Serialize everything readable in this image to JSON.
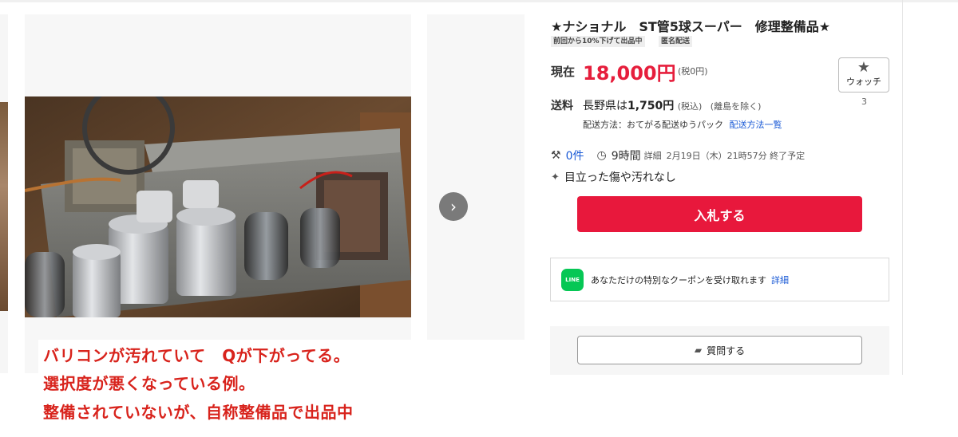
{
  "listing": {
    "title": "★ナショナル　ST管5球スーパー　修理整備品★",
    "badges": [
      "前回から10%下げて出品中",
      "匿名配送"
    ],
    "price_label": "現在",
    "price": "18,000円",
    "tax": "(税0円)"
  },
  "watch": {
    "label": "ウォッチ",
    "count": "3",
    "icon": "star-icon"
  },
  "shipping": {
    "label": "送料",
    "prefix": "長野県は",
    "fee": "1,750円",
    "tax_note": "(税込)",
    "exclusion": "(離島を除く)",
    "method_text": "配送方法：おてがる配送ゆうパック",
    "method_link": "配送方法一覧"
  },
  "meta": {
    "bids": "0件",
    "time_left": "9時間",
    "detail_link": "詳細",
    "end_date": "2月19日（木）21時57分 終了予定"
  },
  "condition": "目立った傷や汚れなし",
  "bid_button": "入札する",
  "coupon": {
    "icon_text": "LINE",
    "text": "あなただけの特別なクーポンを受け取れます",
    "link": "詳細"
  },
  "question_button": "質問する",
  "gallery": {
    "next_icon": "chevron-right-icon"
  },
  "annotation": [
    "バリコンが汚れていて　Qが下がってる。",
    "選択度が悪くなっている例。",
    "整備されていないが、自称整備品で出品中"
  ],
  "colors": {
    "price": "#e61e3c",
    "bid_button": "#e8183c",
    "annotation": "#d8231c",
    "link": "#1a5ad6",
    "line": "#06c755"
  }
}
